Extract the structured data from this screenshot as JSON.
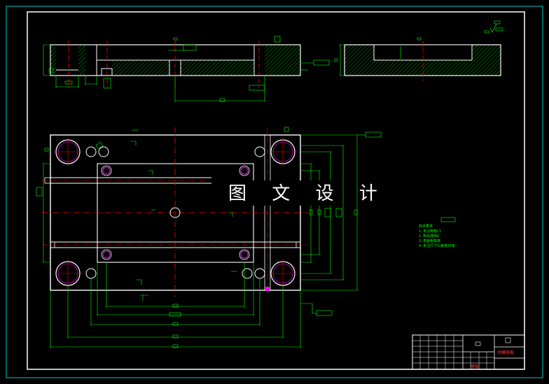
{
  "watermark": "图 文 设 计",
  "title_block": {
    "name_cell": "模板",
    "right_cell": "动模座板",
    "box_label": "□"
  },
  "notes": {
    "lines": [
      "技术要求",
      "1.未注倒角C1",
      "2.热处理HRC",
      "3.表面粗糙度",
      "4.未注尺寸公差按IT级"
    ]
  },
  "colors": {
    "background": "#000000",
    "outline": "#ffffff",
    "dimension": "#00ff00",
    "centerline": "#ff0000",
    "border": "#00c8c8",
    "hole": "#ff00ff"
  }
}
